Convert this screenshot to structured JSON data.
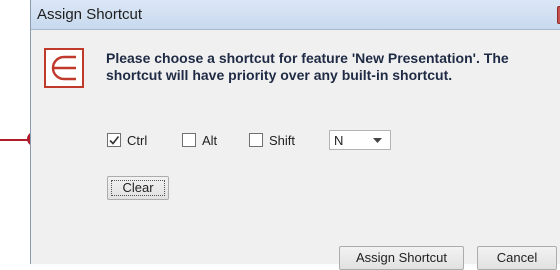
{
  "window": {
    "title": "Assign Shortcut"
  },
  "message": "Please choose a shortcut for feature 'New Presentation'. The shortcut will have priority over any built-in shortcut.",
  "modifiers": [
    {
      "label": "Ctrl",
      "checked": true
    },
    {
      "label": "Alt",
      "checked": false
    },
    {
      "label": "Shift",
      "checked": false
    }
  ],
  "key_select": {
    "value": "N"
  },
  "buttons": {
    "clear": "Clear",
    "assign": "Assign Shortcut",
    "cancel": "Cancel"
  },
  "colors": {
    "accent": "#b01c2c"
  },
  "icons": {
    "feature": "presentation-e-icon",
    "close": "close-icon"
  }
}
